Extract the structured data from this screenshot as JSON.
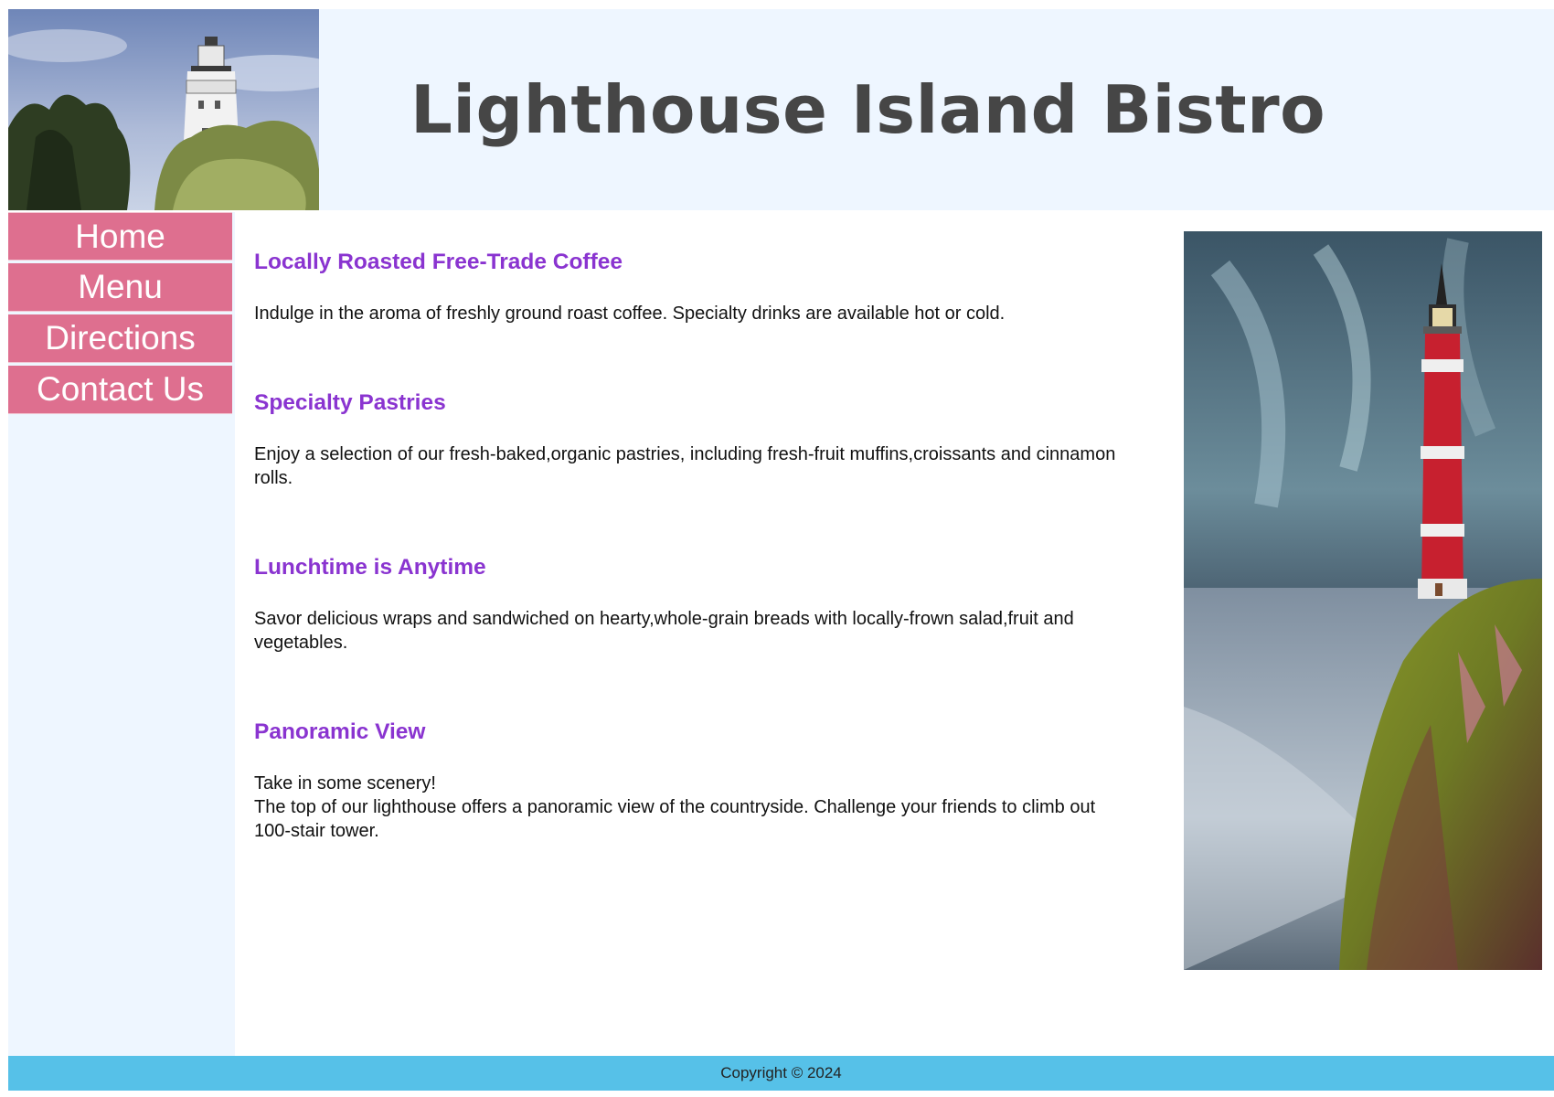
{
  "header": {
    "title": "Lighthouse Island Bistro"
  },
  "nav": {
    "items": [
      {
        "label": "Home"
      },
      {
        "label": "Menu"
      },
      {
        "label": "Directions"
      },
      {
        "label": "Contact Us"
      }
    ]
  },
  "main": {
    "sections": [
      {
        "title": "Locally Roasted Free-Trade Coffee",
        "text": "Indulge in the aroma of freshly ground roast coffee. Specialty drinks are available hot or cold."
      },
      {
        "title": "Specialty Pastries",
        "text": "Enjoy a selection of our fresh-baked,organic pastries, including fresh-fruit muffins,croissants and cinnamon rolls."
      },
      {
        "title": "Lunchtime is Anytime",
        "text": "Savor delicious wraps and sandwiched on hearty,whole-grain breads with locally-frown salad,fruit and vegetables."
      },
      {
        "title": "Panoramic View",
        "text_line1": "Take in some scenery!",
        "text": "The top of our lighthouse offers a panoramic view of the countryside. Challenge your friends to climb out 100-stair tower."
      }
    ]
  },
  "footer": {
    "copyright": "Copyright © 2024"
  },
  "colors": {
    "header_bg": "#eef6ff",
    "nav_bg": "#de6f8f",
    "heading": "#8a34d0",
    "footer_bg": "#56c1e8"
  }
}
